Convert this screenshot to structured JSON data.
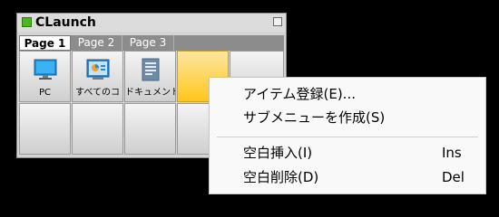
{
  "window": {
    "title": "CLaunch",
    "icon": "app-square-icon",
    "accent": "#47b81e"
  },
  "tabs": [
    {
      "label": "Page 1",
      "active": true
    },
    {
      "label": "Page 2",
      "active": false
    },
    {
      "label": "Page 3",
      "active": false
    }
  ],
  "items": [
    {
      "label": "PC",
      "icon": "monitor-icon"
    },
    {
      "label": "すべてのコ",
      "icon": "control-panel-icon"
    },
    {
      "label": "ドキュメント",
      "icon": "document-icon"
    }
  ],
  "selected_cell_color": "#ffc61a",
  "menu": {
    "items": [
      {
        "label": "アイテム登録(E)...",
        "shortcut": ""
      },
      {
        "label": "サブメニューを作成(S)",
        "shortcut": ""
      },
      {
        "label": "空白挿入(I)",
        "shortcut": "Ins"
      },
      {
        "label": "空白削除(D)",
        "shortcut": "Del"
      }
    ]
  }
}
